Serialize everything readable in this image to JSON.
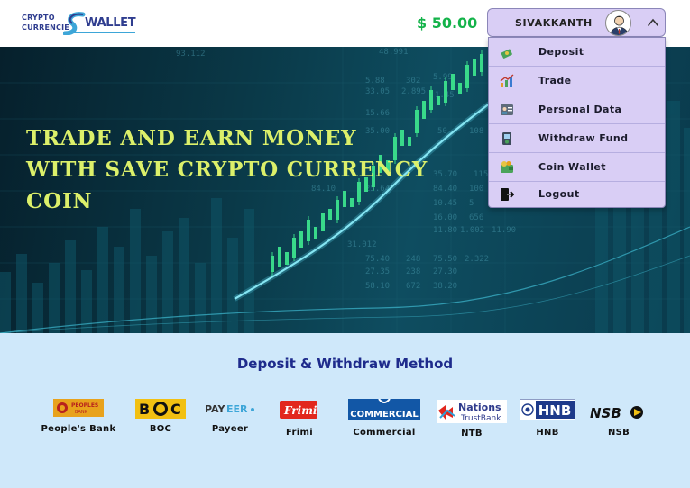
{
  "header": {
    "logo": {
      "line1": "CRYPTO",
      "line2": "CURRENCIE",
      "word": "WALLET"
    },
    "balance": "$ 50.00",
    "user": {
      "name": "SIVAKKANTH"
    }
  },
  "dropdown": {
    "items": [
      {
        "label": "Deposit",
        "icon": "deposit-icon"
      },
      {
        "label": "Trade",
        "icon": "trade-icon"
      },
      {
        "label": "Personal Data",
        "icon": "personal-data-icon"
      },
      {
        "label": "Withdraw Fund",
        "icon": "withdraw-icon"
      },
      {
        "label": "Coin Wallet",
        "icon": "coin-wallet-icon"
      },
      {
        "label": "Logout",
        "icon": "logout-icon"
      }
    ]
  },
  "hero": {
    "title_lines": [
      "TRADE AND EARN MONEY",
      "WITH SAVE CRYPTO CURRENCY",
      "COIN"
    ]
  },
  "methods": {
    "title": "Deposit & Withdraw Method",
    "banks": [
      {
        "name": "People's Bank",
        "logo_text": "PEOPLES BANK",
        "color": "#e8a21c"
      },
      {
        "name": "BOC",
        "logo_text": "BOC",
        "color": "#f2c012"
      },
      {
        "name": "Payeer",
        "logo_text": "PAYEER",
        "color": "#444444"
      },
      {
        "name": "Frimi",
        "logo_text": "Frimi",
        "color": "#e2271d"
      },
      {
        "name": "Commercial",
        "logo_text": "COMMERCIAL",
        "color": "#1257a6"
      },
      {
        "name": "NTB",
        "logo_text": "Nations TrustBank",
        "color": "#2e3a8c"
      },
      {
        "name": "HNB",
        "logo_text": "HNB",
        "color": "#1e3a8a"
      },
      {
        "name": "NSB",
        "logo_text": "NSB",
        "color": "#111111"
      }
    ]
  }
}
